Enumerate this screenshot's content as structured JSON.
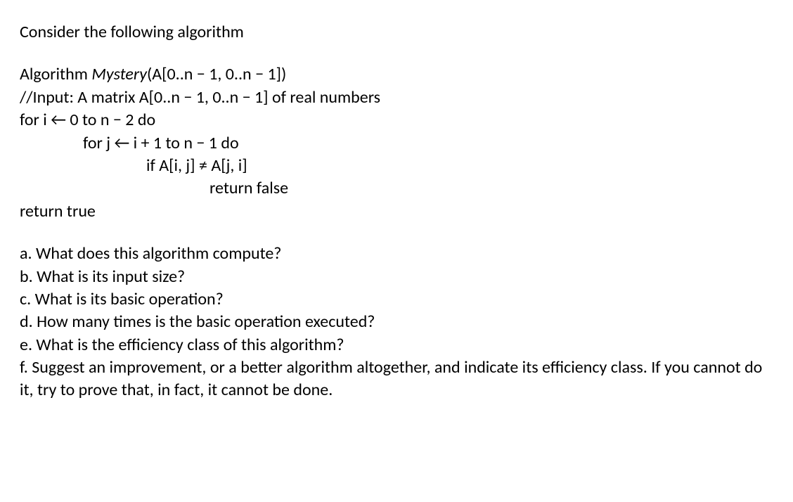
{
  "intro": "Consider the following algorithm",
  "algo": {
    "header_prefix": "Algorithm ",
    "header_name": "Mystery",
    "header_suffix": "(A[0..n − 1, 0..n − 1])",
    "input": "//Input: A matrix A[0..n − 1, 0..n − 1] of real numbers",
    "line1": "for i ← 0 to n − 2 do",
    "line2": "for j ← i + 1 to n − 1 do",
    "line3": "if A[i, j] ≠ A[j, i]",
    "line4": "return false",
    "line5": "return true"
  },
  "q": {
    "a": "a. What does this algorithm compute?",
    "b": "b. What is its input size?",
    "c": "c. What is its basic operation?",
    "d": "d. How many times is the basic operation executed?",
    "e": "e. What is the efficiency class of this algorithm?",
    "f": "f. Suggest an improvement, or a better algorithm altogether, and indicate its efficiency class. If you cannot do it, try to prove that, in fact, it cannot be done."
  }
}
